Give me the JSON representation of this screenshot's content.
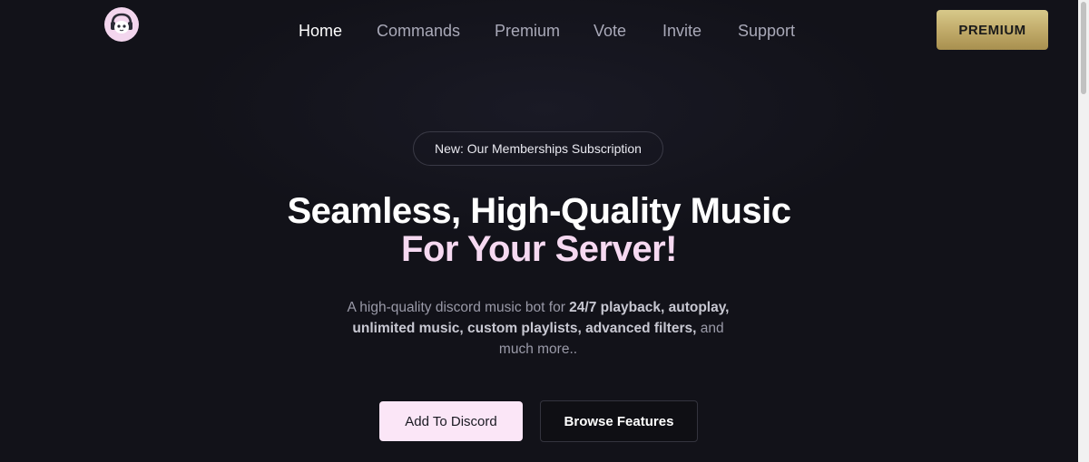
{
  "nav": {
    "items": [
      {
        "label": "Home",
        "active": true
      },
      {
        "label": "Commands",
        "active": false
      },
      {
        "label": "Premium",
        "active": false
      },
      {
        "label": "Vote",
        "active": false
      },
      {
        "label": "Invite",
        "active": false
      },
      {
        "label": "Support",
        "active": false
      }
    ],
    "premium_button": "PREMIUM"
  },
  "logo": {
    "icon": "bot-avatar-icon"
  },
  "announcement": {
    "label": "New: Our Memberships Subscription"
  },
  "hero": {
    "title_line1": "Seamless, High-Quality Music",
    "title_line2": "For Your Server!",
    "description": {
      "t1": "A high-quality discord music bot for ",
      "b1": "24/7 playback, autoplay,",
      "b2": "unlimited music, custom playlists, advanced filters,",
      "t2": " and",
      "t3": "much more.."
    },
    "primary_button": "Add To Discord",
    "secondary_button": "Browse Features"
  },
  "colors": {
    "background": "#121219",
    "accent_pink": "#fbe6f7",
    "premium_gold": "#c9b776",
    "nav_inactive": "#a9a9b8"
  }
}
